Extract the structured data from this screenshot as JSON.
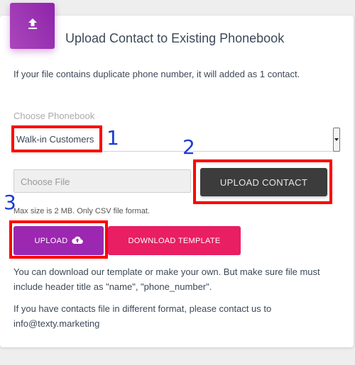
{
  "header": {
    "icon": "upload-icon",
    "title": "Upload Contact to Existing Phonebook"
  },
  "info_text": "If your file contains duplicate phone number, it will added as 1 contact.",
  "phonebook": {
    "label": "Choose Phonebook",
    "selected": "Walk-in Customers"
  },
  "file_input": {
    "placeholder": "Choose File"
  },
  "buttons": {
    "upload_contact": "UPLOAD CONTACT",
    "upload": "UPLOAD",
    "download_template": "DOWNLOAD TEMPLATE"
  },
  "hint": "Max size is 2 MB. Only CSV file format.",
  "paragraphs": {
    "template_note": "You can download our template or make your own. But make sure file must include header title as \"name\", \"phone_number\".",
    "contact_note": "If you have contacts file in different format, please contact us to info@texty.marketing"
  },
  "annotations": {
    "one": "1",
    "two": "2",
    "three": "3"
  },
  "colors": {
    "upload_button": "#9c27b0",
    "download_button": "#e91e63",
    "upload_contact_button": "#3c3c3c",
    "annotation_box": "#ff0000",
    "annotation_number": "#1a3bd6"
  }
}
